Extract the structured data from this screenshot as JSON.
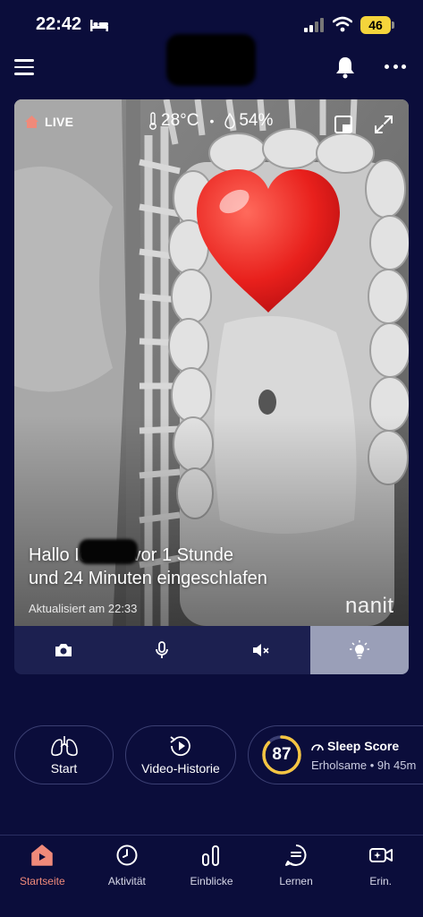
{
  "status_bar": {
    "time": "22:42",
    "battery": "46",
    "battery_color": "#f5d43b"
  },
  "header": {
    "menu_icon": "hamburger-icon",
    "notifications_icon": "bell-icon",
    "more_icon": "more-dots-icon"
  },
  "camera": {
    "live_label": "LIVE",
    "temperature": "28°C",
    "humidity": "54%",
    "separator": "•",
    "message_line1": "Hallo       Ich bin vor 1 Stunde",
    "message_line2": "und 24 Minuten eingeschlafen",
    "updated": "Aktualisiert am 22:33",
    "brand": "nanit",
    "overlay_sticker": "heart-emoji"
  },
  "controls": {
    "items": [
      {
        "icon": "camera-icon",
        "active": false
      },
      {
        "icon": "microphone-icon",
        "active": false
      },
      {
        "icon": "speaker-muted-icon",
        "active": false
      },
      {
        "icon": "light-bulb-icon",
        "active": true
      }
    ]
  },
  "actions": {
    "start_label": "Start",
    "video_label": "Video-Historie",
    "sleep_score_title": "Sleep Score",
    "sleep_score_value": "87",
    "sleep_score_sub": "Erholsame • 9h 45m"
  },
  "nav": {
    "items": [
      {
        "label": "Startseite",
        "icon": "home-icon",
        "active": true
      },
      {
        "label": "Aktivität",
        "icon": "clock-icon",
        "active": false
      },
      {
        "label": "Einblicke",
        "icon": "bar-chart-icon",
        "active": false
      },
      {
        "label": "Lernen",
        "icon": "chat-list-icon",
        "active": false
      },
      {
        "label": "Erin.",
        "icon": "video-sparkle-icon",
        "active": false
      }
    ]
  },
  "colors": {
    "background": "#0b0d3b",
    "accent": "#f08a7a",
    "control_bar": "#1c2050",
    "score_ring": "#f5c542"
  }
}
